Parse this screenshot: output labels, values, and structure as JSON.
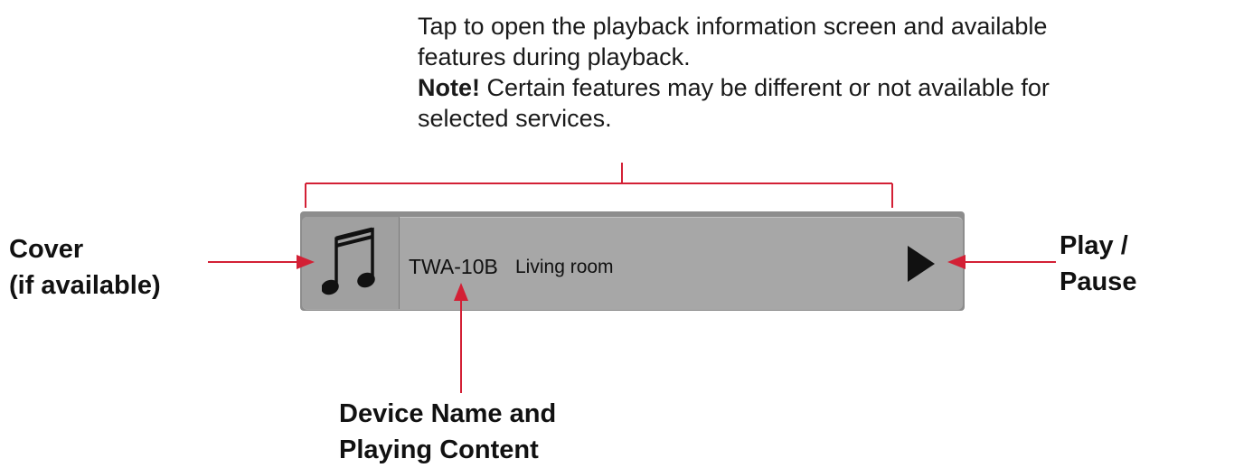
{
  "top_note": {
    "line1": "Tap to open the playback information screen and available",
    "line2": "features during playback.",
    "note_label": "Note!",
    "note_text": " Certain features may be different or not available for",
    "line4": "selected services."
  },
  "callouts": {
    "cover_line1": "Cover",
    "cover_line2": "(if available)",
    "play_line1": "Play /",
    "play_line2": "Pause",
    "device_line1": "Device Name and",
    "device_line2": "Playing Content"
  },
  "player": {
    "device_name": "TWA-10B",
    "content": "Living room",
    "cover_icon": "music-note-icon",
    "play_icon": "play-icon"
  },
  "colors": {
    "arrow": "#d32035",
    "bar": "#a7a7a7",
    "bar_frame": "#8d8d8d"
  }
}
